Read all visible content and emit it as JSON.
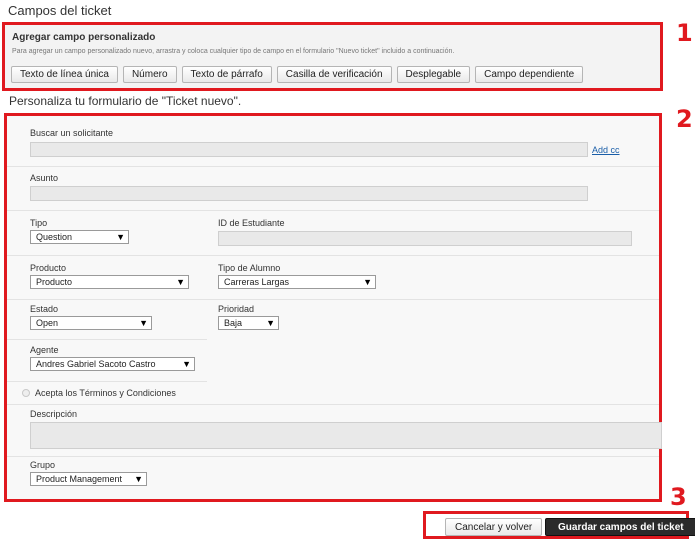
{
  "page_title": "Campos del ticket",
  "markers": [
    "1",
    "2",
    "3"
  ],
  "custom_field": {
    "heading": "Agregar campo personalizado",
    "description": "Para agregar un campo personalizado nuevo, arrastra y coloca cualquier tipo de campo en el formulario \"Nuevo ticket\" incluido a continuación.",
    "buttons": [
      "Texto de línea única",
      "Número",
      "Texto de párrafo",
      "Casilla de verificación",
      "Desplegable",
      "Campo dependiente"
    ]
  },
  "form_heading": "Personaliza tu formulario de \"Ticket nuevo\".",
  "form": {
    "requester_label": "Buscar un solicitante",
    "add_cc": "Add cc",
    "subject_label": "Asunto",
    "type_label": "Tipo",
    "type_value": "Question",
    "student_id_label": "ID de Estudiante",
    "product_label": "Producto",
    "product_value": "Producto",
    "student_type_label": "Tipo de Alumno",
    "student_type_value": "Carreras Largas",
    "status_label": "Estado",
    "status_value": "Open",
    "priority_label": "Prioridad",
    "priority_value": "Baja",
    "agent_label": "Agente",
    "agent_value": "Andres Gabriel Sacoto Castro",
    "terms_label": "Acepta los Términos y Condiciones",
    "description_label": "Descripción",
    "group_label": "Grupo",
    "group_value": "Product Management"
  },
  "footer": {
    "cancel": "Cancelar y volver",
    "save": "Guardar campos del ticket"
  },
  "colors": {
    "annotation_red": "#e0191f",
    "primary_button": "#2b2b2b",
    "link": "#1a5ea8"
  }
}
